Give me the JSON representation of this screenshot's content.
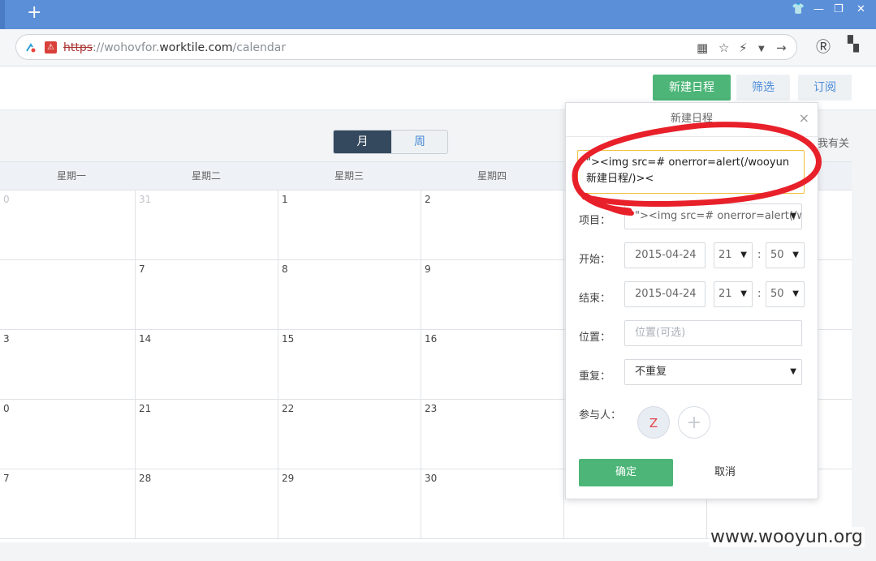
{
  "browser": {
    "url_scheme": "https",
    "url_separator": "://",
    "url_subdomain": "wohovfor.",
    "url_host": "worktile.com",
    "url_path": "/calendar",
    "colors": {
      "titlebar": "#5b8fd8",
      "lock_warning": "#d9403a"
    }
  },
  "header": {
    "new_event_label": "新建日程",
    "filter_label": "筛选",
    "subscribe_label": "订阅"
  },
  "calendar": {
    "view_month_label": "月",
    "view_week_label": "周",
    "side_text": "我有关",
    "weekdays": [
      "星期一",
      "星期二",
      "星期三",
      "星期四"
    ],
    "rows": [
      [
        "0",
        "31",
        "1",
        "2"
      ],
      [
        "",
        "7",
        "8",
        "9"
      ],
      [
        "3",
        "14",
        "15",
        "16"
      ],
      [
        "0",
        "21",
        "22",
        "23"
      ],
      [
        "7",
        "28",
        "29",
        "30"
      ]
    ]
  },
  "dialog": {
    "title": "新建日程",
    "close_glyph": "×",
    "event_title_value": "\"><img src=# onerror=alert(/wooyun新建日程/)><",
    "project_label": "项目：",
    "project_value": "\"><img src=# onerror=alert(/wooyun新建日程/)><",
    "start_label": "开始：",
    "start_date": "2015-04-24",
    "start_hour": "21",
    "start_minute": "50",
    "end_label": "结束：",
    "end_date": "2015-04-24",
    "end_hour": "21",
    "end_minute": "50",
    "location_label": "位置：",
    "location_placeholder": "位置(可选)",
    "repeat_label": "重复：",
    "repeat_value": "不重复",
    "participants_label": "参与人：",
    "participant_initial": "Z",
    "add_participant_glyph": "+",
    "confirm_label": "确定",
    "cancel_label": "取消",
    "colors": {
      "primary": "#4cb577",
      "link": "#4a8bd8",
      "dark_toggle": "#34495e"
    }
  },
  "annotation": {
    "color": "#e8202a"
  },
  "watermark": "www.wooyun.org"
}
